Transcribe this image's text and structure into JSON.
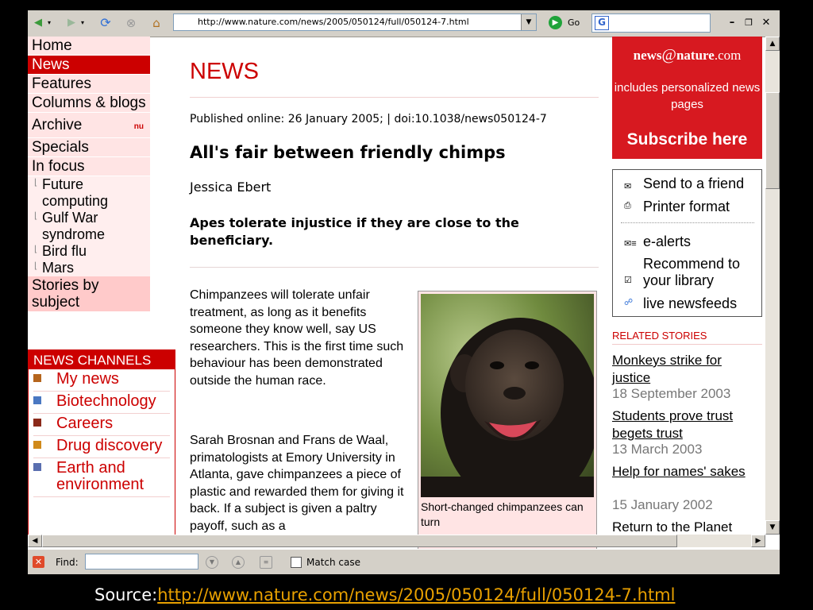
{
  "browser": {
    "url": "http://www.nature.com/news/2005/050124/full/050124-7.html",
    "go_label": "Go",
    "search_value": ""
  },
  "nav": {
    "items": [
      {
        "label": "Home"
      },
      {
        "label": "News"
      },
      {
        "label": "Features"
      },
      {
        "label": "Columns & blogs"
      },
      {
        "label": "Archive"
      },
      {
        "label": "Specials"
      },
      {
        "label": "In focus"
      }
    ],
    "archive_badge": "nu",
    "in_focus_subitems": [
      "Future computing",
      "Gulf War syndrome",
      "Bird flu",
      "Mars"
    ],
    "stories_by_subject": "Stories by subject"
  },
  "channels": {
    "heading": "NEWS CHANNELS",
    "items": [
      {
        "label": "My news",
        "color": "#b5651d"
      },
      {
        "label": "Biotechnology",
        "color": "#4a78c2"
      },
      {
        "label": "Careers",
        "color": "#8b2a1a"
      },
      {
        "label": "Drug discovery",
        "color": "#d08a1a"
      },
      {
        "label": "Earth and environment",
        "color": "#5a6fb0"
      }
    ]
  },
  "article": {
    "section": "NEWS",
    "published": "Published online: 26 January 2005; | doi:10.1038/news050124-7",
    "headline": "All's fair between friendly chimps",
    "author": "Jessica Ebert",
    "standfirst": "Apes tolerate injustice if they are close to the beneficiary.",
    "para1": "Chimpanzees will tolerate unfair treatment, as long as it benefits someone they know well, say US researchers. This is the first time such behaviour has been demonstrated outside the human race.",
    "para2": "Sarah Brosnan and Frans de Waal, primatologists at Emory University in Atlanta, gave chimpanzees a piece of plastic and rewarded them for giving it back. If a subject is given a paltry payoff, such as a",
    "caption": "Short-changed chimpanzees can turn"
  },
  "promo": {
    "brand_prefix": "news",
    "brand_at": "@",
    "brand_suffix": "nature",
    "brand_tld": ".com",
    "includes": "includes personalized news pages",
    "subscribe": "Subscribe here"
  },
  "tools": {
    "send": "Send to a friend",
    "printer": "Printer format",
    "ealerts": "e-alerts",
    "recommend": "Recommend to your library",
    "newsfeeds": "live newsfeeds"
  },
  "related": {
    "heading": "RELATED STORIES",
    "stories": [
      {
        "title": "Monkeys strike for justice",
        "date": "18 September 2003"
      },
      {
        "title": "Students prove trust begets trust",
        "date": "13 March 2003"
      },
      {
        "title": "Help for names' sakes",
        "date": "15 January 2002"
      },
      {
        "title": "Return to the Planet",
        "date": ""
      }
    ]
  },
  "findbar": {
    "label": "Find:",
    "value": "",
    "match_case": "Match case"
  },
  "source": {
    "label": "Source:",
    "url": "http://www.nature.com/news/2005/050124/full/050124-7.html"
  }
}
